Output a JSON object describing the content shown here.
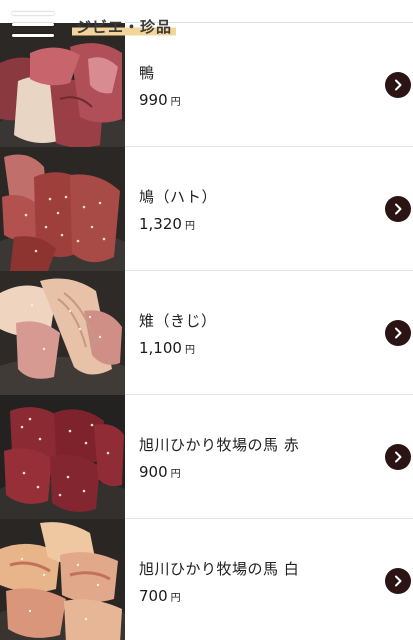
{
  "header": {
    "menu_icon": "hamburger-menu-icon",
    "category": "ジビエ・珍品"
  },
  "colors": {
    "category_highlight": "#f2d59a",
    "arrow_button_bg": "#2a1414",
    "divider": "#e4e4e4"
  },
  "items": [
    {
      "name": "鴨",
      "price": "990",
      "unit": "円",
      "image": "duck-meat-photo",
      "action_icon": "chevron-right-icon"
    },
    {
      "name": "鳩（ハト）",
      "price": "1,320",
      "unit": "円",
      "image": "pigeon-meat-photo",
      "action_icon": "chevron-right-icon"
    },
    {
      "name": "雉（きじ）",
      "price": "1,100",
      "unit": "円",
      "image": "pheasant-meat-photo",
      "action_icon": "chevron-right-icon"
    },
    {
      "name": "旭川ひかり牧場の馬 赤",
      "price": "900",
      "unit": "円",
      "image": "horse-red-meat-photo",
      "action_icon": "chevron-right-icon"
    },
    {
      "name": "旭川ひかり牧場の馬 白",
      "price": "700",
      "unit": "円",
      "image": "horse-white-meat-photo",
      "action_icon": "chevron-right-icon"
    }
  ]
}
